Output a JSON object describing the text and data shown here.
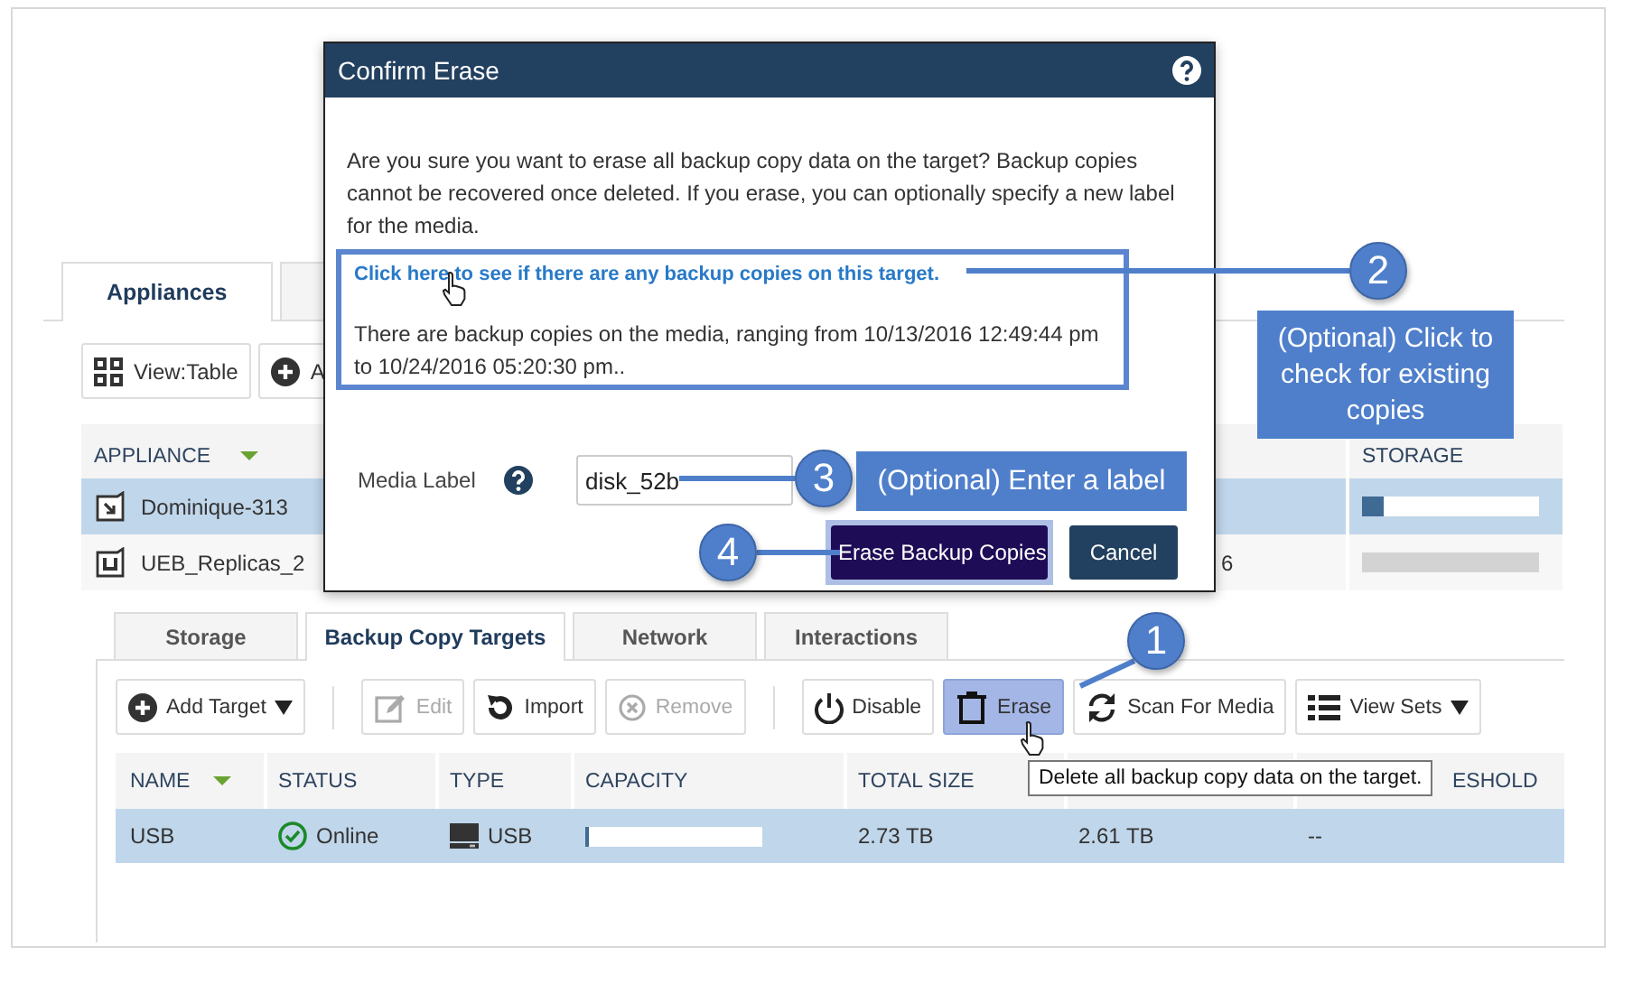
{
  "appliances": {
    "tabs": [
      {
        "label": "Appliances",
        "selected": true
      },
      {
        "selected": false
      }
    ],
    "toolbar": [
      {
        "kind": "grid",
        "label": "View:Table"
      },
      {
        "kind": "add",
        "label": "A"
      }
    ],
    "columns": [
      {
        "label": "APPLIANCE",
        "sorted": true
      },
      {
        "label": "STORAGE",
        "sorted": false
      }
    ],
    "rows": [
      {
        "kind": "appliance",
        "name": "Dominique-313",
        "selected": true,
        "storage": {
          "level": 0.12,
          "disabled": false
        }
      },
      {
        "kind": "replica",
        "name": "UEB_Replicas_2",
        "selected": false,
        "column_2": "6",
        "storage": {
          "level": 0,
          "disabled": true
        }
      }
    ]
  },
  "targets": {
    "tabs": [
      {
        "label": "Storage",
        "selected": false
      },
      {
        "label": "Backup Copy Targets",
        "selected": true
      },
      {
        "label": "Network",
        "selected": false
      },
      {
        "label": "Interactions",
        "selected": false
      }
    ],
    "toolbar": [
      {
        "kind": "add",
        "label": "Add Target",
        "dropdown": true,
        "disabled": false,
        "highlighted": false
      },
      {
        "kind": "separator"
      },
      {
        "kind": "edit",
        "label": "Edit",
        "dropdown": false,
        "disabled": true,
        "highlighted": false
      },
      {
        "kind": "import",
        "label": "Import",
        "dropdown": false,
        "disabled": false,
        "highlighted": false
      },
      {
        "kind": "remove",
        "label": "Remove",
        "dropdown": false,
        "disabled": true,
        "highlighted": false
      },
      {
        "kind": "separator"
      },
      {
        "kind": "power",
        "label": "Disable",
        "dropdown": false,
        "disabled": false,
        "highlighted": false
      },
      {
        "kind": "erase",
        "label": "Erase",
        "dropdown": false,
        "disabled": false,
        "highlighted": true
      },
      {
        "kind": "scan",
        "label": "Scan For Media",
        "dropdown": false,
        "disabled": false,
        "highlighted": false
      },
      {
        "kind": "list",
        "label": "View Sets",
        "dropdown": true,
        "disabled": false,
        "highlighted": false
      }
    ],
    "columns": [
      {
        "label": "NAME",
        "sorted": true
      },
      {
        "label": "STATUS",
        "sorted": false
      },
      {
        "label": "TYPE",
        "sorted": false
      },
      {
        "label": "CAPACITY",
        "sorted": false
      },
      {
        "label": "TOTAL SIZE",
        "sorted": false
      },
      {},
      {
        "label": "ESHOLD",
        "sorted": false
      }
    ],
    "rows": [
      {
        "name": "USB",
        "status": "Online",
        "online": true,
        "type": "USB",
        "capacity": {
          "level": 0.02
        },
        "total_size": "2.73 TB",
        "column_6": "2.61 TB",
        "column_7": "--",
        "selected": true
      }
    ],
    "tooltip": "Delete all backup copy data on the target."
  },
  "dialog": {
    "title": "Confirm Erase",
    "message": "Are you sure you want to erase all backup copy data on the target? Backup copies cannot be recovered once deleted. If you erase, you can optionally specify a new label for the media.",
    "link": "Click here to see if there are any backup copies on this target.",
    "info": "There are backup copies on the media, ranging from 10/13/2016 12:49:44 pm to 10/24/2016 05:20:30 pm..",
    "media_label": "Media Label",
    "media_value": "disk_52b",
    "buttons": [
      {
        "label": "Erase Backup Copies",
        "kind": "primary",
        "highlighted": true
      },
      {
        "label": "Cancel",
        "kind": "secondary",
        "highlighted": false
      }
    ]
  },
  "callouts": [
    {
      "number": "1"
    },
    {
      "number": "2",
      "note": "(Optional) Click to check for existing copies"
    },
    {
      "number": "3",
      "note": "(Optional) Enter a label"
    },
    {
      "number": "4"
    }
  ]
}
